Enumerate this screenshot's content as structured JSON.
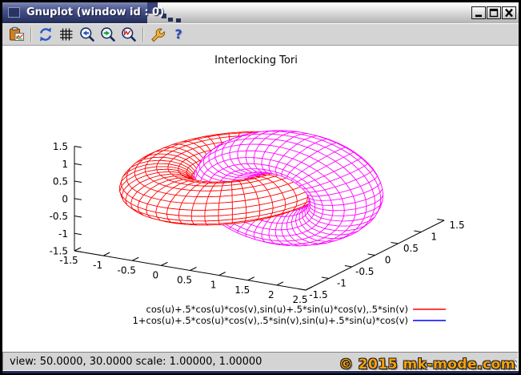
{
  "window": {
    "title": "Gnuplot (window id : 0)",
    "controls": [
      {
        "name": "minimize",
        "icon": "minimize-icon"
      },
      {
        "name": "maximize",
        "icon": "maximize-icon"
      },
      {
        "name": "close",
        "icon": "close-icon"
      }
    ]
  },
  "toolbar": {
    "buttons": [
      {
        "name": "copy-to-clipboard",
        "icon": "clipboard-chart-icon"
      },
      {
        "name": "replot",
        "icon": "refresh-icon"
      },
      {
        "name": "toggle-grid",
        "icon": "grid-icon"
      },
      {
        "name": "previous-zoom",
        "icon": "zoom-previous-icon"
      },
      {
        "name": "next-zoom",
        "icon": "zoom-next-icon"
      },
      {
        "name": "autoscale",
        "icon": "zoom-autoscale-icon"
      },
      {
        "name": "options",
        "icon": "wrench-icon"
      },
      {
        "name": "help",
        "icon": "question-mark-icon"
      }
    ]
  },
  "plot": {
    "chart_data": {
      "type": "surface3d_wireframe",
      "title": "Interlocking Tori",
      "view": {
        "rot_x": 50.0,
        "rot_z": 30.0,
        "scale": [
          1.0,
          1.0
        ]
      },
      "grid": false,
      "legend_position": "below-plot-right",
      "axes": {
        "x": {
          "min": -1.5,
          "max": 2.5,
          "ticks": [
            -1.5,
            -1,
            -0.5,
            0,
            0.5,
            1,
            1.5,
            2,
            2.5
          ]
        },
        "y": {
          "min": -1.5,
          "max": 1.5,
          "ticks": [
            -1.5,
            -1,
            -0.5,
            0,
            0.5,
            1,
            1.5
          ]
        },
        "z": {
          "min": -1.5,
          "max": 1.5,
          "ticks": [
            -1.5,
            -1,
            -0.5,
            0,
            0.5,
            1,
            1.5
          ]
        }
      },
      "isosamples": [
        50,
        20
      ],
      "surfaces": [
        {
          "formula": "cos(u)+.5*cos(u)*cos(v),sin(u)+.5*sin(u)*cos(v),.5*sin(v)",
          "shape": "torus",
          "plane": "xy",
          "center": [
            0,
            0,
            0
          ],
          "R": 1.0,
          "r": 0.5,
          "color": "#ff0000",
          "legend_color": "#ff0000"
        },
        {
          "formula": "1+cos(u)+.5*cos(u)*cos(v),.5*sin(v),sin(u)+.5*sin(u)*cos(v)",
          "shape": "torus",
          "plane": "xz",
          "center": [
            1,
            0,
            0
          ],
          "R": 1.0,
          "r": 0.5,
          "color": "#ff00ff",
          "legend_color": "#0000ff"
        }
      ]
    }
  },
  "statusbar": {
    "text": "view: 50.0000, 30.0000  scale: 1.00000, 1.00000"
  },
  "watermark": {
    "text": "© 2015 mk-mode.com",
    "color": "#f5a00a"
  }
}
